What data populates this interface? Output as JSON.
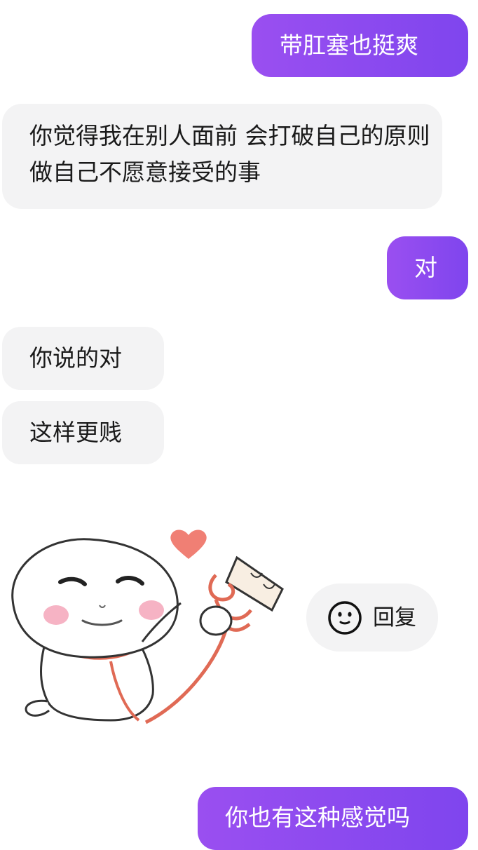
{
  "messages": [
    {
      "side": "outgoing",
      "text": "带肛塞也挺爽"
    },
    {
      "side": "incoming",
      "text": "你觉得我在别人面前 会打破自己的原则 做自己不愿意接受的事"
    },
    {
      "side": "outgoing",
      "text": "对"
    },
    {
      "side": "incoming",
      "text": "你说的对"
    },
    {
      "side": "incoming",
      "text": "这样更贱"
    },
    {
      "side": "outgoing",
      "text": "你也有这种感觉吗"
    }
  ],
  "reply_action": {
    "label": "回复",
    "icon": "smiley-face-icon"
  },
  "sticker": {
    "icon": "cartoon-sticker-tied-with-rope-icon"
  },
  "colors": {
    "outgoing_bubble": "#8b4aef",
    "incoming_bubble": "#f3f3f4",
    "heart": "#f07f74",
    "rope": "#e06a55"
  }
}
